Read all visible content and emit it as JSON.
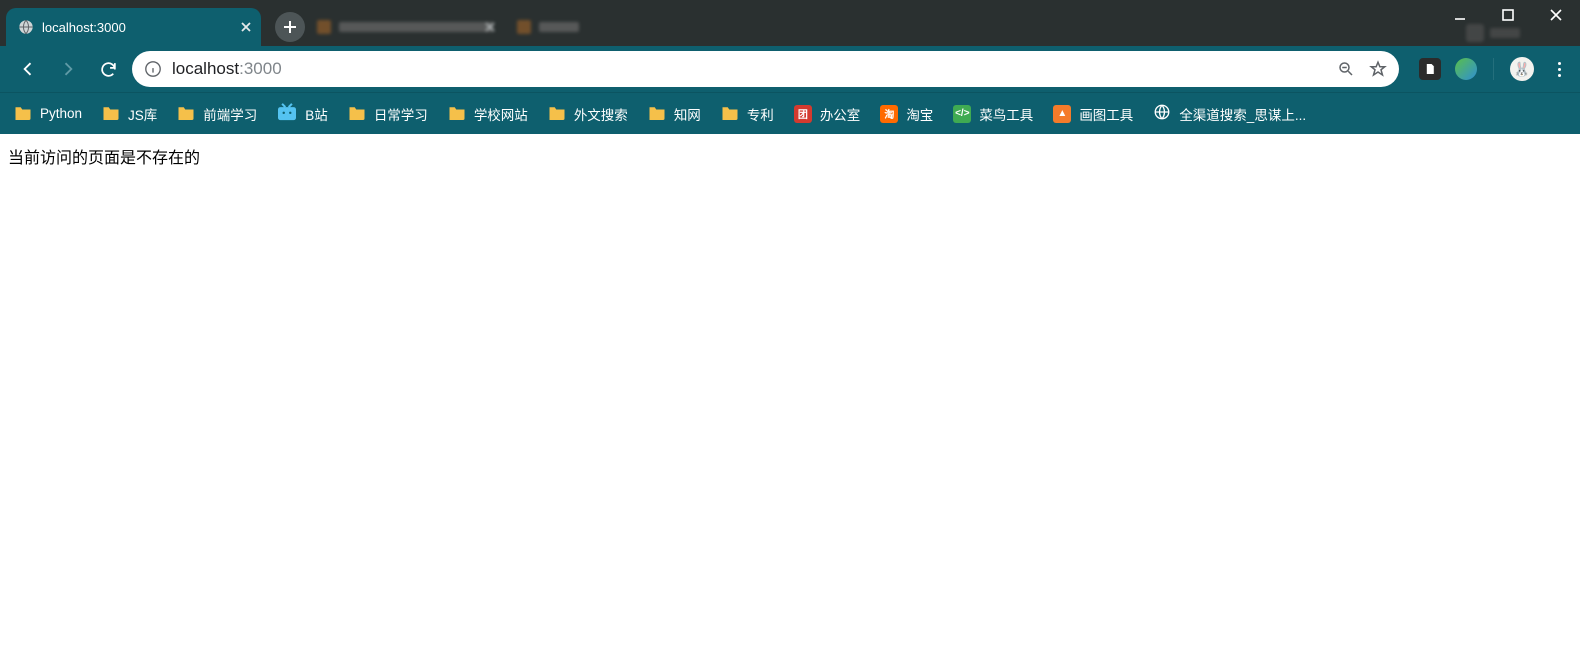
{
  "titlebar": {
    "active_tab": {
      "title": "localhost:3000"
    },
    "inactive_tabs": [
      {
        "title": ""
      },
      {
        "title": ""
      }
    ]
  },
  "address": {
    "host": "localhost",
    "port": ":3000"
  },
  "bookmarks": [
    {
      "label": "Python",
      "icon": "folder"
    },
    {
      "label": "JS库",
      "icon": "folder"
    },
    {
      "label": "前端学习",
      "icon": "folder"
    },
    {
      "label": "B站",
      "icon": "bili"
    },
    {
      "label": "日常学习",
      "icon": "folder"
    },
    {
      "label": "学校网站",
      "icon": "folder"
    },
    {
      "label": "外文搜索",
      "icon": "folder"
    },
    {
      "label": "知网",
      "icon": "folder"
    },
    {
      "label": "专利",
      "icon": "folder"
    },
    {
      "label": "办公室",
      "icon": "office"
    },
    {
      "label": "淘宝",
      "icon": "taobao"
    },
    {
      "label": "菜鸟工具",
      "icon": "runoob"
    },
    {
      "label": "画图工具",
      "icon": "draw"
    },
    {
      "label": "全渠道搜索_思谋上...",
      "icon": "globe"
    }
  ],
  "page": {
    "body_text": "当前访问的页面是不存在的"
  }
}
